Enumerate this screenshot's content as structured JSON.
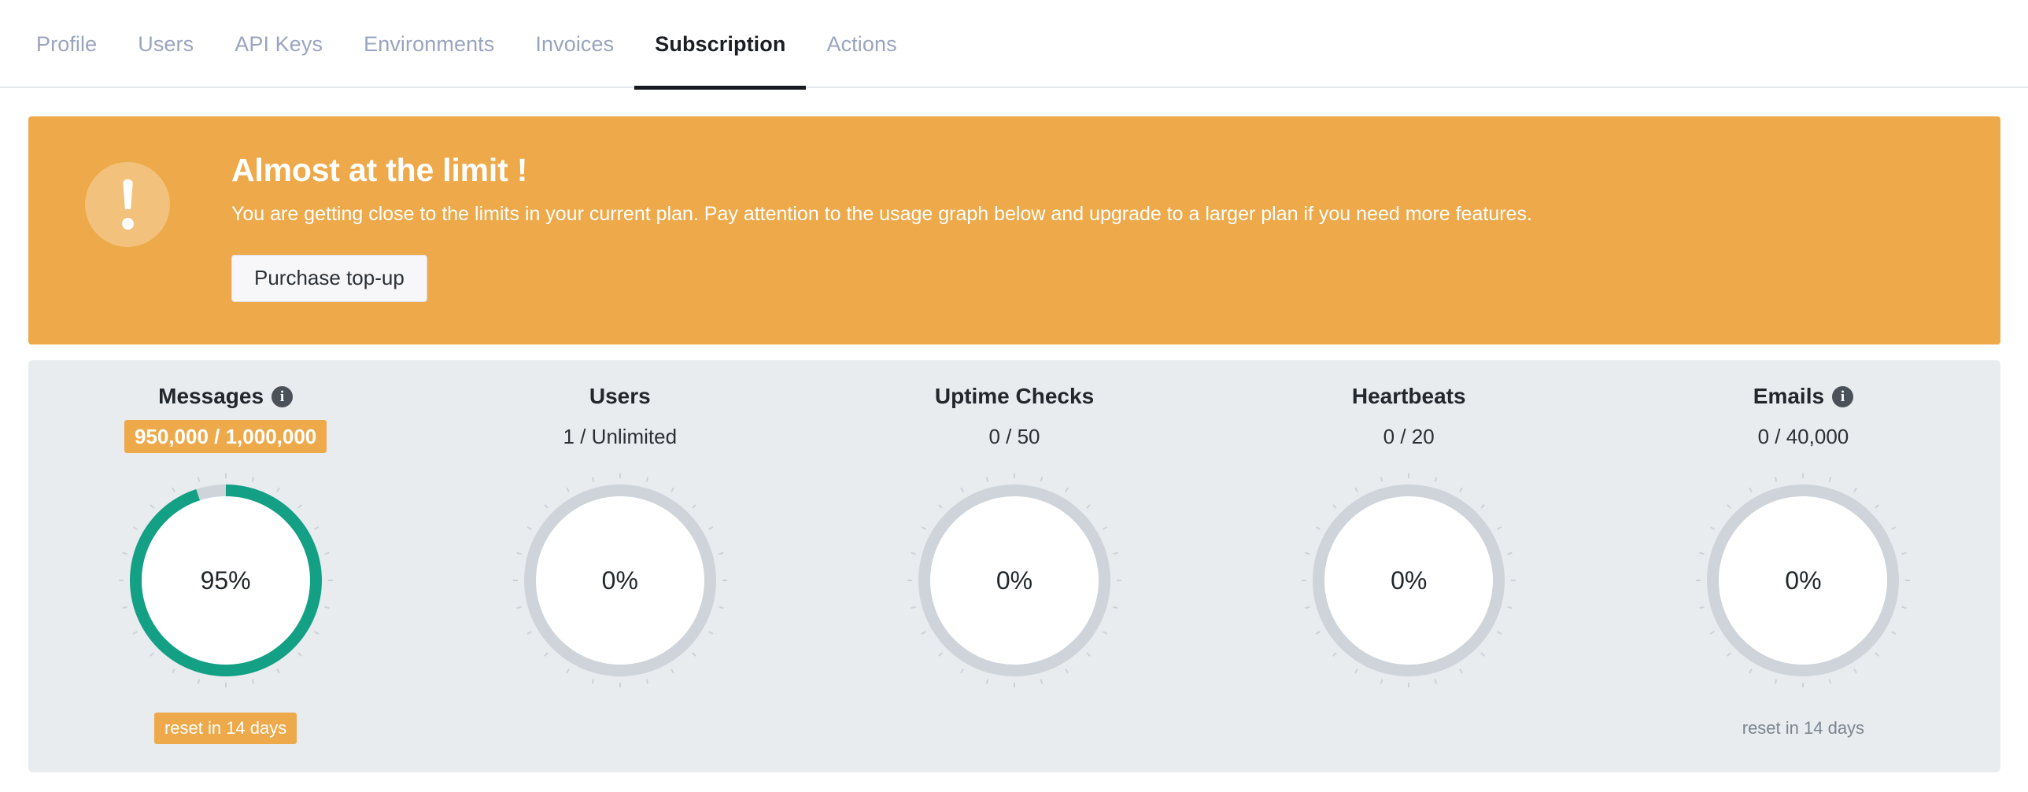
{
  "tabs": [
    {
      "label": "Profile",
      "active": false
    },
    {
      "label": "Users",
      "active": false
    },
    {
      "label": "API Keys",
      "active": false
    },
    {
      "label": "Environments",
      "active": false
    },
    {
      "label": "Invoices",
      "active": false
    },
    {
      "label": "Subscription",
      "active": true
    },
    {
      "label": "Actions",
      "active": false
    }
  ],
  "alert": {
    "icon": "exclamation-icon",
    "title": "Almost at the limit !",
    "text": "You are getting close to the limits in your current plan. Pay attention to the usage graph below and upgrade to a larger plan if you need more features.",
    "button_label": "Purchase top-up",
    "background_color": "#eda94a"
  },
  "colors": {
    "accent_orange": "#eda94a",
    "gauge_fill": "#13a085",
    "gauge_track": "#ced4da",
    "panel_bg": "#e8ecef",
    "tab_inactive": "#9aa4bf",
    "tab_active": "#1b1f24"
  },
  "usage": {
    "cards": [
      {
        "title": "Messages",
        "has_info_icon": true,
        "usage": "950,000 / 1,000,000",
        "usage_warn": true,
        "percent_label": "95%",
        "percent": 95,
        "footer": "reset in 14 days",
        "footer_warn": true,
        "footer_visible": true
      },
      {
        "title": "Users",
        "has_info_icon": false,
        "usage": "1 / Unlimited",
        "usage_warn": false,
        "percent_label": "0%",
        "percent": 0,
        "footer": "",
        "footer_warn": false,
        "footer_visible": false
      },
      {
        "title": "Uptime Checks",
        "has_info_icon": false,
        "usage": "0 / 50",
        "usage_warn": false,
        "percent_label": "0%",
        "percent": 0,
        "footer": "",
        "footer_warn": false,
        "footer_visible": false
      },
      {
        "title": "Heartbeats",
        "has_info_icon": false,
        "usage": "0 / 20",
        "usage_warn": false,
        "percent_label": "0%",
        "percent": 0,
        "footer": "",
        "footer_warn": false,
        "footer_visible": false
      },
      {
        "title": "Emails",
        "has_info_icon": true,
        "usage": "0 / 40,000",
        "usage_warn": false,
        "percent_label": "0%",
        "percent": 0,
        "footer": "reset in 14 days",
        "footer_warn": false,
        "footer_visible": true
      }
    ]
  },
  "info_icon_glyph": "i"
}
